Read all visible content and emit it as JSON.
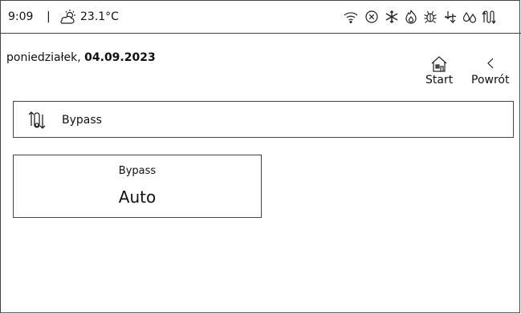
{
  "status": {
    "time": "9:09",
    "separator": "|",
    "temperature": "23.1°C",
    "icons": [
      "weather-partly-cloudy-icon",
      "wifi-icon",
      "circle-x-icon",
      "snowflake-icon",
      "flame-icon",
      "bug-icon",
      "bypass-arrows-icon",
      "drops-icon",
      "bypass-icon"
    ]
  },
  "header": {
    "weekday": "poniedziałek, ",
    "date": "04.09.2023",
    "start_label": "Start",
    "back_label": "Powrót"
  },
  "section": {
    "title": "Bypass"
  },
  "tile": {
    "title": "Bypass",
    "value": "Auto"
  }
}
